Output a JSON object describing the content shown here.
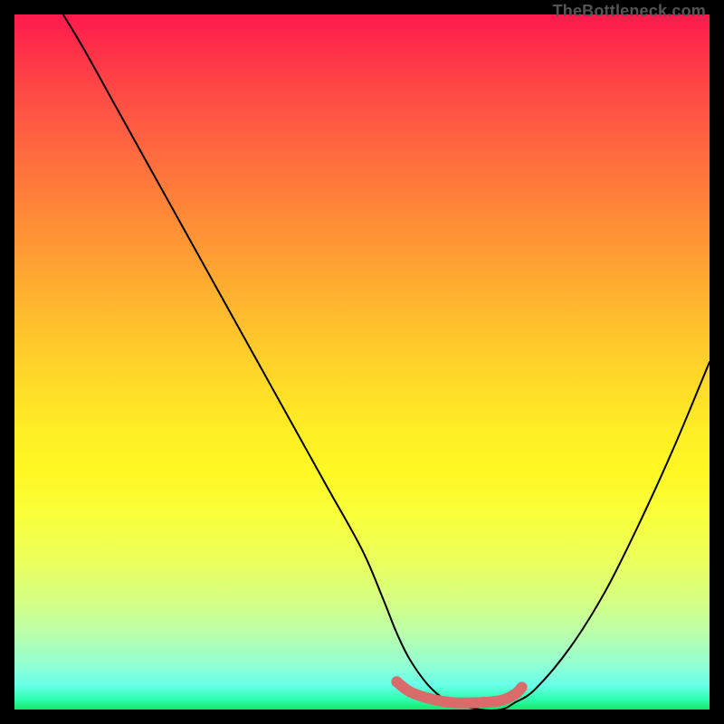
{
  "watermark": "TheBottleneck.com",
  "chart_data": {
    "type": "line",
    "title": "",
    "xlabel": "",
    "ylabel": "",
    "xlim": [
      0,
      100
    ],
    "ylim": [
      0,
      100
    ],
    "grid": false,
    "legend": false,
    "series": [
      {
        "name": "bottleneck-curve",
        "color": "#000000",
        "x": [
          7,
          10,
          15,
          20,
          25,
          30,
          35,
          40,
          45,
          50,
          53,
          55,
          57,
          60,
          63,
          67,
          70,
          72,
          75,
          80,
          85,
          90,
          95,
          100
        ],
        "y": [
          100,
          95,
          86,
          77,
          68,
          59,
          50,
          41,
          32,
          23,
          16,
          11,
          7,
          3,
          1,
          0,
          0,
          1,
          3,
          9,
          17,
          27,
          38,
          50
        ]
      },
      {
        "name": "highlight-segment",
        "color": "#d96b6b",
        "x": [
          55,
          57,
          60,
          63,
          67,
          70,
          72,
          73
        ],
        "y": [
          4,
          2.5,
          1.5,
          1,
          1,
          1.3,
          2.2,
          3.2
        ]
      }
    ],
    "markers": [
      {
        "name": "highlight-start-dot",
        "x": 55,
        "y": 4,
        "color": "#d96b6b",
        "r": 6
      }
    ]
  }
}
